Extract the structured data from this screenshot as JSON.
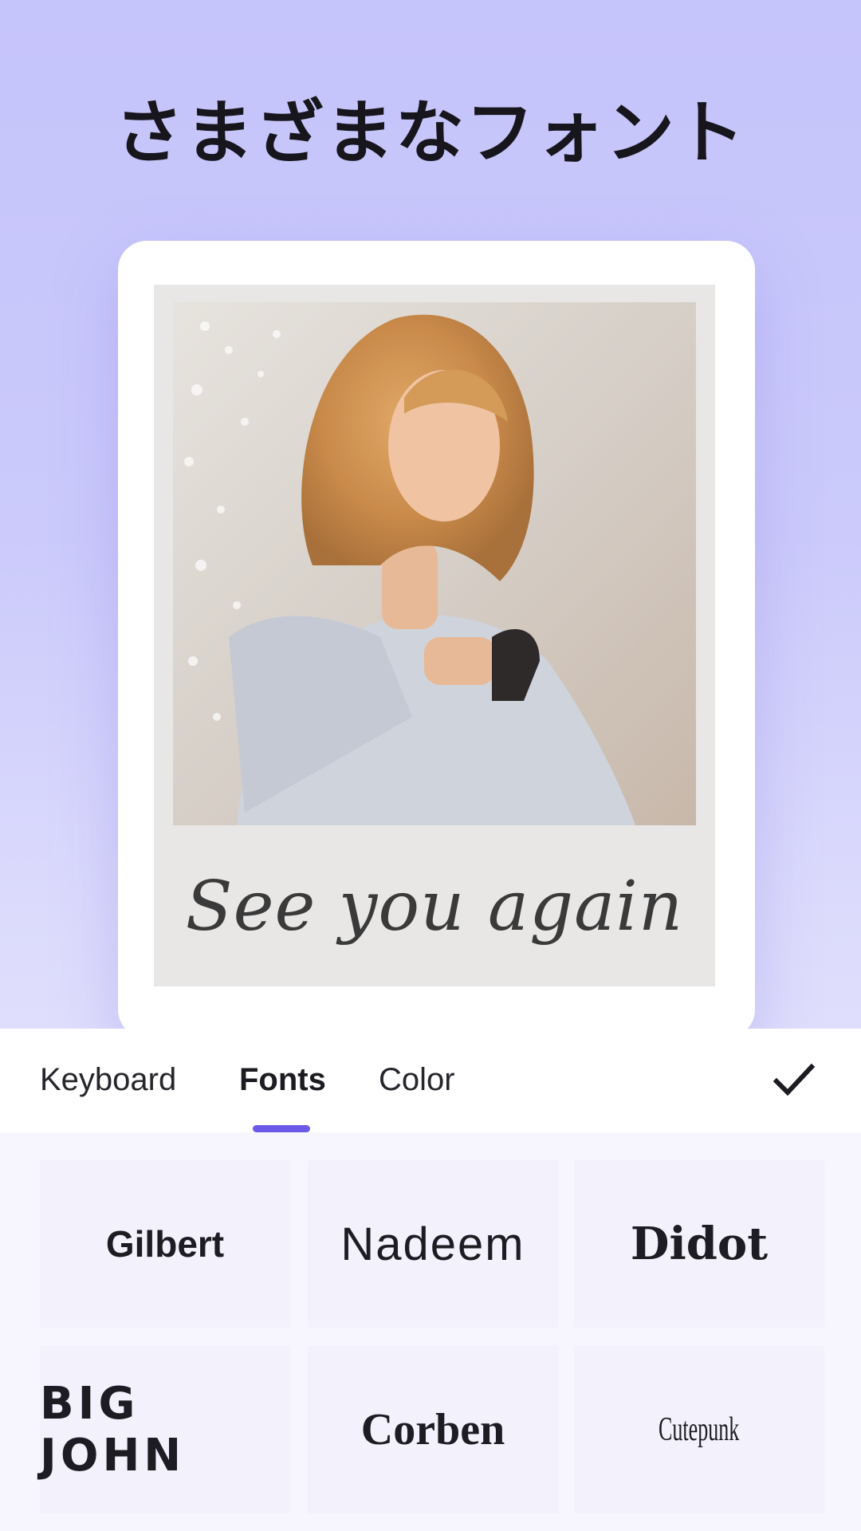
{
  "header": {
    "title": "さまざまなフォント"
  },
  "preview": {
    "caption": "See you again",
    "photo_icon": "woman-on-beach-photo"
  },
  "editor": {
    "tabs": [
      {
        "label": "Keyboard",
        "selected": false
      },
      {
        "label": "Fonts",
        "selected": true
      },
      {
        "label": "Color",
        "selected": false
      }
    ],
    "confirm_icon": "checkmark-icon",
    "accent_color": "#6b5ae8"
  },
  "fonts": [
    {
      "label": "Gilbert"
    },
    {
      "label": "Nadeem"
    },
    {
      "label": "Didot"
    },
    {
      "label": "BIG JOHN"
    },
    {
      "label": "Corben"
    },
    {
      "label": "Cutepunk"
    }
  ]
}
